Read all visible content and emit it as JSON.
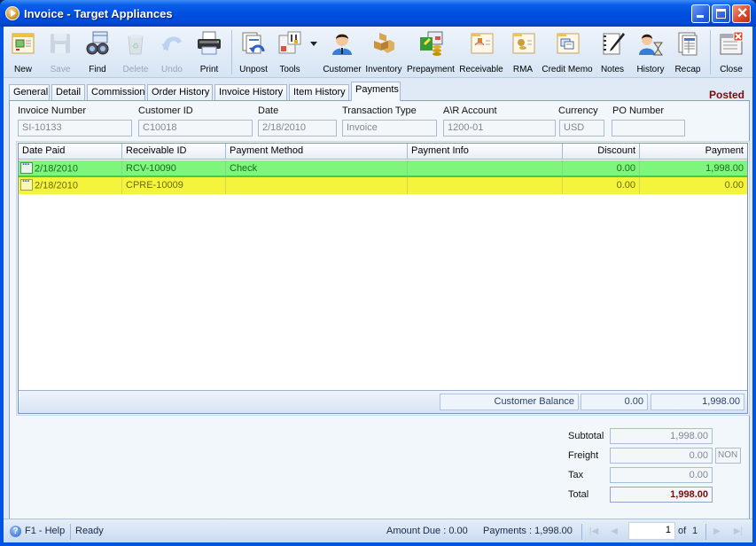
{
  "window": {
    "title": "Invoice - Target Appliances"
  },
  "toolbar": {
    "buttons": [
      {
        "label": "New",
        "icon": "new-document-icon",
        "enabled": true
      },
      {
        "label": "Save",
        "icon": "floppy-disk-icon",
        "enabled": false
      },
      {
        "label": "Find",
        "icon": "binoculars-icon",
        "enabled": true
      },
      {
        "label": "Delete",
        "icon": "recycle-bin-icon",
        "enabled": false
      },
      {
        "label": "Undo",
        "icon": "undo-arrow-icon",
        "enabled": false
      },
      {
        "label": "Print",
        "icon": "printer-icon",
        "enabled": true
      },
      {
        "label": "Unpost",
        "icon": "unpost-icon",
        "enabled": true
      },
      {
        "label": "Tools",
        "icon": "tools-icon",
        "enabled": true
      },
      {
        "label": "Customer",
        "icon": "customer-person-icon",
        "enabled": true
      },
      {
        "label": "Inventory",
        "icon": "boxes-icon",
        "enabled": true
      },
      {
        "label": "Prepayment",
        "icon": "prepayment-icon",
        "enabled": true
      },
      {
        "label": "Receivable",
        "icon": "receivable-icon",
        "enabled": true
      },
      {
        "label": "RMA",
        "icon": "rma-icon",
        "enabled": true
      },
      {
        "label": "Credit Memo",
        "icon": "credit-memo-icon",
        "enabled": true
      },
      {
        "label": "Notes",
        "icon": "notebook-pen-icon",
        "enabled": true
      },
      {
        "label": "History",
        "icon": "history-person-hourglass-icon",
        "enabled": true
      },
      {
        "label": "Recap",
        "icon": "recap-sheet-icon",
        "enabled": true
      },
      {
        "label": "Close",
        "icon": "close-window-icon",
        "enabled": true
      }
    ]
  },
  "tabs": [
    {
      "label": "General",
      "active": false
    },
    {
      "label": "Detail",
      "active": false
    },
    {
      "label": "Commission",
      "active": false
    },
    {
      "label": "Order History",
      "active": false
    },
    {
      "label": "Invoice History",
      "active": false
    },
    {
      "label": "Item History",
      "active": false
    },
    {
      "label": "Payments",
      "active": true
    }
  ],
  "status_badge": "Posted",
  "header_fields": {
    "invoice_number": {
      "label": "Invoice Number",
      "value": "SI-10133"
    },
    "customer_id": {
      "label": "Customer ID",
      "value": "C10018"
    },
    "date": {
      "label": "Date",
      "value": "2/18/2010"
    },
    "transaction_type": {
      "label": "Transaction Type",
      "value": "Invoice"
    },
    "ar_account": {
      "label": "A\\R Account",
      "value": "1200-01"
    },
    "currency": {
      "label": "Currency",
      "value": "USD"
    },
    "po_number": {
      "label": "PO Number",
      "value": ""
    }
  },
  "payments_grid": {
    "columns": [
      "Date Paid",
      "Receivable ID",
      "Payment Method",
      "Payment Info",
      "Discount",
      "Payment"
    ],
    "rows": [
      {
        "date_paid": "2/18/2010",
        "receivable_id": "RCV-10090",
        "payment_method": "Check",
        "payment_info": "",
        "discount": "0.00",
        "payment": "1,998.00",
        "highlight": "#7ef67e"
      },
      {
        "date_paid": "2/18/2010",
        "receivable_id": "CPRE-10009",
        "payment_method": "",
        "payment_info": "",
        "discount": "0.00",
        "payment": "0.00",
        "highlight": "#f4f43c"
      }
    ],
    "footer": {
      "label": "Customer Balance",
      "discount_total": "0.00",
      "payment_total": "1,998.00"
    }
  },
  "totals": {
    "subtotal": {
      "label": "Subtotal",
      "value": "1,998.00"
    },
    "freight": {
      "label": "Freight",
      "value": "0.00",
      "code": "NON"
    },
    "tax": {
      "label": "Tax",
      "value": "0.00"
    },
    "total": {
      "label": "Total",
      "value": "1,998.00"
    }
  },
  "statusbar": {
    "help": "F1 - Help",
    "status": "Ready",
    "amount_due": "Amount Due : 0.00",
    "payments": "Payments : 1,998.00",
    "page_current": "1",
    "page_of": "of",
    "page_total": "1"
  },
  "colors": {
    "posted": "#7a0b0b",
    "row_green": "#7ef67e",
    "row_yellow": "#f4f43c",
    "titlebar": "#0050e0"
  }
}
